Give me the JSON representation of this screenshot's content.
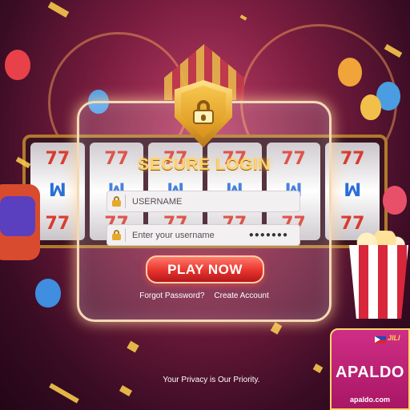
{
  "login": {
    "title": "SECURE LOGIN",
    "username_placeholder": "USERNAME",
    "password_placeholder": "Enter your username",
    "password_mask": "●●●●●●●",
    "play_button": "PLAY NOW",
    "forgot_password": "Forgot Password?",
    "create_account": "Create Account"
  },
  "footer": {
    "privacy": "Your Privacy is Our Priority."
  },
  "badge": {
    "brand": "APALDO",
    "provider": "JILI",
    "domain": "apaldo.com"
  },
  "background": {
    "reel_symbols": [
      "77",
      "77",
      "77"
    ]
  },
  "colors": {
    "accent_gold": "#ffd36a",
    "button_red": "#e8332c",
    "badge_pink": "#c0247a"
  }
}
